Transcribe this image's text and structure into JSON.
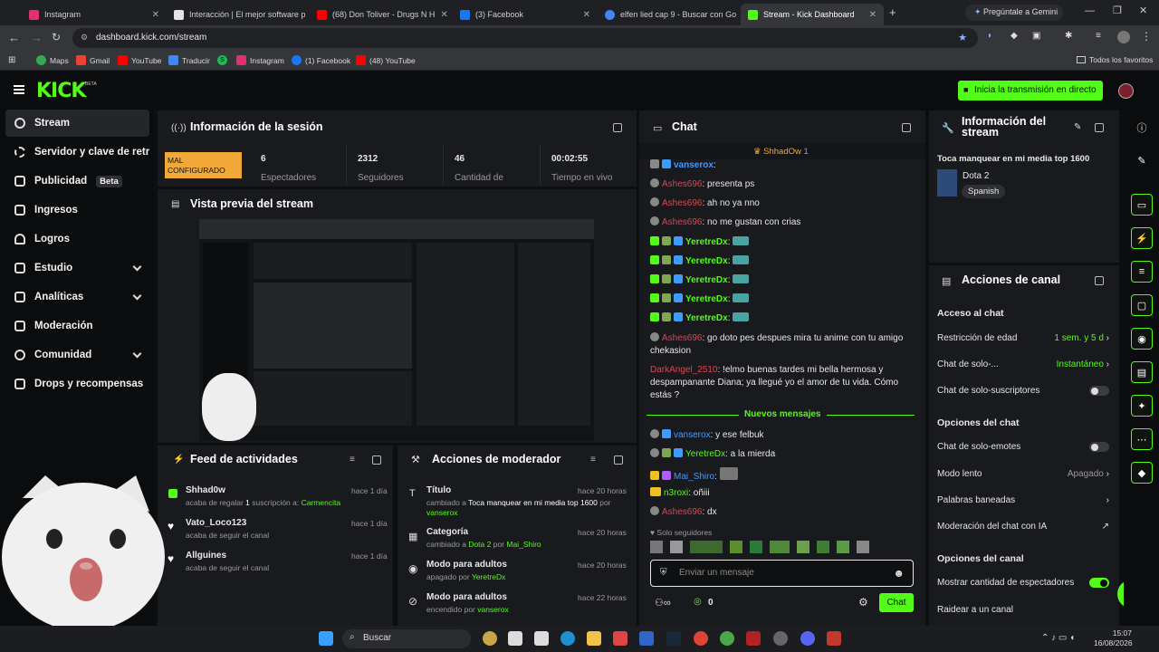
{
  "browser": {
    "tabs": [
      {
        "title": "Instagram",
        "color": "#e1306c"
      },
      {
        "title": "Interacción | El mejor software p",
        "color": "#e5e5e5"
      },
      {
        "title": "(68) Don Toliver - Drugs N H",
        "color": "#ff0000"
      },
      {
        "title": "(3) Facebook",
        "color": "#1877f2"
      },
      {
        "title": "elfen lied cap 9 - Buscar con Go",
        "color": "#4285f4"
      },
      {
        "title": "Stream - Kick Dashboard",
        "color": "#53fc18"
      }
    ],
    "gemini_button": "Pregúntale a Gemini",
    "url": "dashboard.kick.com/stream",
    "bookmarks": [
      "Maps",
      "Gmail",
      "YouTube",
      "Traducir",
      "S",
      "Instagram",
      "(1) Facebook",
      "(48) YouTube"
    ],
    "all_bookmarks": "Todos los favoritos"
  },
  "header": {
    "logo": "KICK",
    "logo_beta": "BETA",
    "start_stream_button": "Inicia la transmisión en directo"
  },
  "sidebar": {
    "items": [
      {
        "label": "Stream"
      },
      {
        "label": "Servidor y clave de retransmisión"
      },
      {
        "label": "Publicidad",
        "badge": "Beta"
      },
      {
        "label": "Ingresos"
      },
      {
        "label": "Logros"
      },
      {
        "label": "Estudio"
      },
      {
        "label": "Analíticas"
      },
      {
        "label": "Moderación"
      },
      {
        "label": "Comunidad"
      },
      {
        "label": "Drops y recompensas"
      }
    ]
  },
  "session": {
    "title": "Información de la sesión",
    "status": "MAL CONFIGURADO",
    "stats": [
      {
        "value": "6",
        "label": "Espectadores"
      },
      {
        "value": "2312",
        "label": "Seguidores"
      },
      {
        "value": "46",
        "label": "Cantidad de"
      },
      {
        "value": "00:02:55",
        "label": "Tiempo en vivo"
      }
    ]
  },
  "preview": {
    "title": "Vista previa del stream"
  },
  "activity": {
    "title": "Feed de actividades",
    "items": [
      {
        "user": "Shhad0w",
        "time": "hace 1 día",
        "text_a": "acaba de regalar ",
        "count": "1",
        "text_b": " suscripción a: ",
        "target": "Carmencita"
      },
      {
        "user": "Vato_Loco123",
        "time": "hace 1 día",
        "text": "acaba de seguir el canal"
      },
      {
        "user": "Allguines",
        "time": "hace 1 día",
        "text": "acaba de seguir el canal"
      }
    ]
  },
  "mod_actions": {
    "title": "Acciones de moderador",
    "items": [
      {
        "title": "Título",
        "time": "hace 20 horas",
        "line1": "cambiado a ",
        "value": "Toca manquear en mi media top 1600",
        "by": " por",
        "user": "vanserox"
      },
      {
        "title": "Categoría",
        "time": "hace 20 horas",
        "line1": "cambiado a ",
        "value": "Dota 2",
        "by": " por ",
        "user": "Mai_Shiro"
      },
      {
        "title": "Modo para adultos",
        "time": "hace 20 horas",
        "line1": "apagado por ",
        "user": "YeretreDx"
      },
      {
        "title": "Modo para adultos",
        "time": "hace 22 horas",
        "line1": "encendido por ",
        "user": "vanserox"
      }
    ]
  },
  "chat": {
    "title": "Chat",
    "pinned_user": "ShhadOw",
    "pinned_count": "1",
    "messages": [
      {
        "user": "vanserox",
        "text": ":",
        "color": "#3e9bff"
      },
      {
        "user": "Ashes696",
        "text": ": presenta ps",
        "color": "#e0454d"
      },
      {
        "user": "Ashes696",
        "text": ": ah no ya nno",
        "color": "#e0454d"
      },
      {
        "user": "Ashes696",
        "text": ": no me gustan con crias",
        "color": "#e0454d"
      },
      {
        "user": "YeretreDx",
        "text": ":",
        "color": "#53fc18"
      },
      {
        "user": "YeretreDx",
        "text": ":",
        "color": "#53fc18"
      },
      {
        "user": "YeretreDx",
        "text": ":",
        "color": "#53fc18"
      },
      {
        "user": "YeretreDx",
        "text": ":",
        "color": "#53fc18"
      },
      {
        "user": "YeretreDx",
        "text": ":",
        "color": "#53fc18"
      },
      {
        "user": "Ashes696",
        "text": ": go doto pes despues mira tu anime con tu amigo",
        "text2": "chekasion",
        "color": "#e0454d"
      },
      {
        "user": "DarkAngel_2510",
        "text": ": !elmo buenas tardes mi bella hermosa y",
        "text2": "despampanante Diana; ya llegué yo el amor de tu vida. Cómo",
        "text3": "estás ?",
        "color": "#e0454d"
      }
    ],
    "new_messages": "Nuevos mensajes",
    "new": [
      {
        "user": "vanserox",
        "text": ": y ese felbuk",
        "color": "#3e9bff"
      },
      {
        "user": "YeretreDx",
        "text": ": a la mierda",
        "color": "#53fc18"
      },
      {
        "user": "Mai_Shiro",
        "text": ":",
        "color": "#3e9bff"
      },
      {
        "user": "n3roxi",
        "text": ": oñiii",
        "color": "#53fc18"
      },
      {
        "user": "Ashes696",
        "text": ": dx",
        "color": "#e0454d"
      }
    ],
    "followers_only": "Solo seguidores",
    "input_placeholder": "Enviar un mensaje",
    "points": "0",
    "send_button": "Chat"
  },
  "stream_info": {
    "title": "Información del stream",
    "stream_title": "Toca manquear en mi media top 1600",
    "category": "Dota 2",
    "language": "Spanish"
  },
  "channel_actions": {
    "title": "Acciones de canal",
    "chat_access": "Acceso al chat",
    "age_restriction": "Restricción de edad",
    "age_value": "1 sem. y 5 d",
    "chat_solo": "Chat de solo-...",
    "chat_solo_value": "Instantáneo",
    "subs_only": "Chat de solo-suscriptores",
    "chat_options": "Opciones del chat",
    "emotes_only": "Chat de solo-emotes",
    "slow_mode": "Modo lento",
    "slow_value": "Apagado",
    "banned_words": "Palabras baneadas",
    "ai_mod": "Moderación del chat con IA",
    "channel_options": "Opciones del canal",
    "show_viewers": "Mostrar cantidad de espectadores",
    "raid": "Raidear a un canal"
  },
  "taskbar": {
    "search": "Buscar",
    "time": "15:07",
    "date": "16/08/2026"
  }
}
